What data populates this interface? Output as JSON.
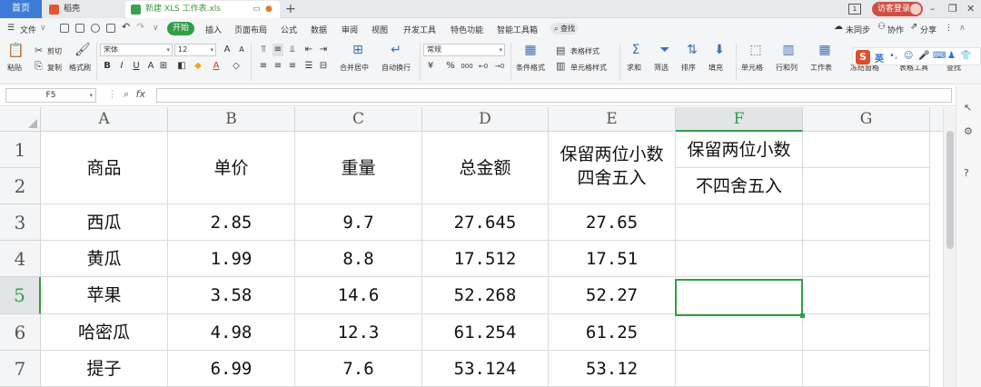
{
  "titlebar": {
    "home_tab": "首页",
    "daoke_tab": "稻壳",
    "file_tab": "新建 XLS 工作表.xls",
    "visitor_login": "访客登录",
    "win_badge": "1"
  },
  "menubar": {
    "file": "文件",
    "start": "开始",
    "tabs": [
      "插入",
      "页面布局",
      "公式",
      "数据",
      "审阅",
      "视图",
      "开发工具",
      "特色功能",
      "智能工具箱"
    ],
    "search": "查找",
    "unsynced": "未同步",
    "collab": "协作",
    "share": "分享"
  },
  "ribbon": {
    "paste": "粘贴",
    "cut": "剪切",
    "copy": "复制",
    "format_painter": "格式刷",
    "font_name": "宋体",
    "font_size": "12",
    "merge_center": "合并居中",
    "wrap_text": "自动换行",
    "number_format": "常规",
    "percent": "%",
    "thousands": "000",
    "cond_format": "条件格式",
    "table_style": "表格样式",
    "cell_style": "单元格样式",
    "sum": "求和",
    "filter": "筛选",
    "sort": "排序",
    "fill": "填充",
    "cell": "单元格",
    "row_col": "行和列",
    "sheet": "工作表",
    "freeze": "冻结窗格",
    "table_tools": "表格工具",
    "find": "查找"
  },
  "ime": {
    "cn": "英"
  },
  "formula": {
    "namebox": "F5",
    "fx": "fx",
    "value": ""
  },
  "grid": {
    "columns": [
      "A",
      "B",
      "C",
      "D",
      "E",
      "F",
      "G"
    ],
    "active_column": "F",
    "rows": [
      "1",
      "2",
      "3",
      "4",
      "5",
      "6",
      "7"
    ],
    "active_row": "5",
    "headers": {
      "a": "商品",
      "b": "单价",
      "c": "重量",
      "d": "总金额",
      "e": "保留两位小数四舍五入",
      "f1": "保留两位小数",
      "f2": "不四舍五入"
    },
    "data": [
      {
        "a": "西瓜",
        "b": "2.85",
        "c": "9.7",
        "d": "27.645",
        "e": "27.65"
      },
      {
        "a": "黄瓜",
        "b": "1.99",
        "c": "8.8",
        "d": "17.512",
        "e": "17.51"
      },
      {
        "a": "苹果",
        "b": "3.58",
        "c": "14.6",
        "d": "52.268",
        "e": "52.27"
      },
      {
        "a": "哈密瓜",
        "b": "4.98",
        "c": "12.3",
        "d": "61.254",
        "e": "61.25"
      },
      {
        "a": "提子",
        "b": "6.99",
        "c": "7.6",
        "d": "53.124",
        "e": "53.12"
      }
    ]
  }
}
